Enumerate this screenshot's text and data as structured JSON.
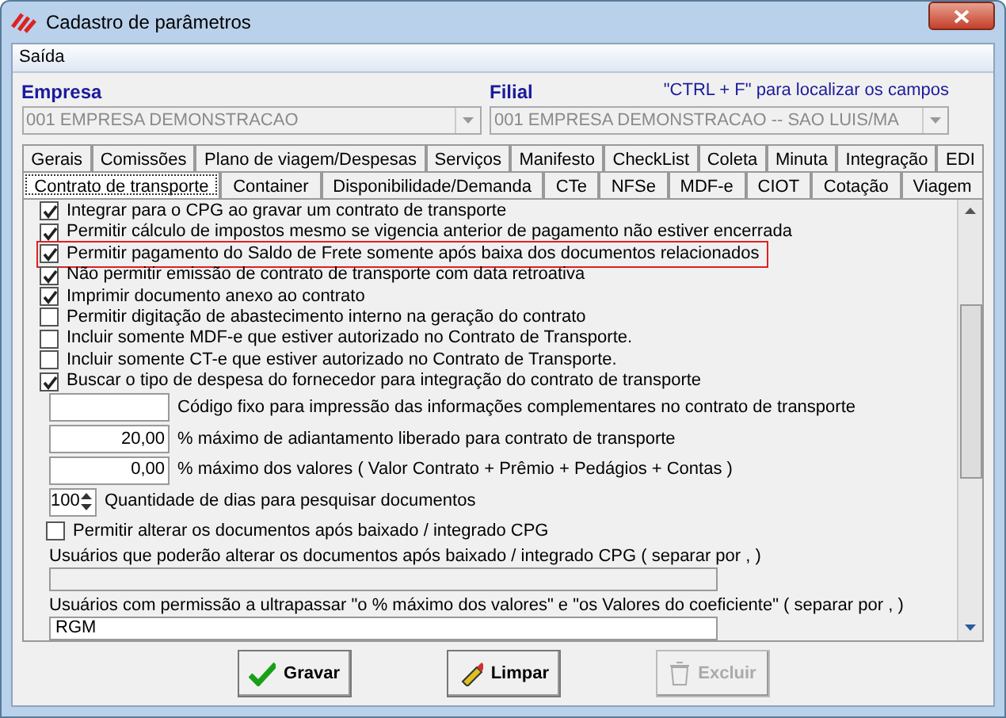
{
  "window": {
    "title": "Cadastro de parâmetros"
  },
  "menu": [
    "Saída"
  ],
  "empresa": {
    "label": "Empresa",
    "value": "001 EMPRESA DEMONSTRACAO"
  },
  "filial": {
    "label": "Filial",
    "value": "001 EMPRESA DEMONSTRACAO -- SAO LUIS/MA",
    "hint": "\"CTRL + F\" para localizar os campos"
  },
  "tab_rows": [
    [
      {
        "label": "Gerais",
        "selected": false
      },
      {
        "label": "Comissões",
        "selected": false
      },
      {
        "label": "Plano de viagem/Despesas",
        "selected": false
      },
      {
        "label": "Serviços",
        "selected": false
      },
      {
        "label": "Manifesto",
        "selected": false
      },
      {
        "label": "CheckList",
        "selected": false
      },
      {
        "label": "Coleta",
        "selected": false
      },
      {
        "label": "Minuta",
        "selected": false
      },
      {
        "label": "Integração",
        "selected": false
      },
      {
        "label": "EDI",
        "selected": false
      }
    ],
    [
      {
        "label": "Contrato de transporte",
        "selected": true
      },
      {
        "label": "Container",
        "selected": false
      },
      {
        "label": "Disponibilidade/Demanda",
        "selected": false
      },
      {
        "label": "CTe",
        "selected": false
      },
      {
        "label": "NFSe",
        "selected": false
      },
      {
        "label": "MDF-e",
        "selected": false
      },
      {
        "label": "CIOT",
        "selected": false
      },
      {
        "label": "Cotação",
        "selected": false
      },
      {
        "label": "Viagem",
        "selected": false
      }
    ]
  ],
  "options": [
    {
      "kind": "check",
      "label": "Integrar para o CPG ao gravar um contrato de transporte",
      "checked": true,
      "highlighted": false
    },
    {
      "kind": "check",
      "label": "Permitir cálculo de impostos mesmo se vigencia anterior de pagamento não estiver encerrada",
      "checked": true,
      "highlighted": false
    },
    {
      "kind": "check",
      "label": "Permitir pagamento do Saldo de Frete somente após baixa dos documentos relacionados",
      "checked": true,
      "highlighted": true
    },
    {
      "kind": "check",
      "label": "Não permitir emissão de contrato de transporte com data retroativa",
      "checked": true,
      "highlighted": false
    },
    {
      "kind": "check",
      "label": "Imprimir documento anexo ao contrato",
      "checked": true,
      "highlighted": false
    },
    {
      "kind": "check",
      "label": "Permitir digitação de abastecimento interno na geração do contrato",
      "checked": false,
      "highlighted": false
    },
    {
      "kind": "check",
      "label": "Incluir somente MDF-e que estiver autorizado no Contrato de Transporte.",
      "checked": false,
      "highlighted": false
    },
    {
      "kind": "check",
      "label": "Incluir somente CT-e que estiver autorizado no Contrato de Transporte.",
      "checked": false,
      "highlighted": false
    },
    {
      "kind": "check",
      "label": "Buscar o tipo de despesa do fornecedor para integração do contrato de transporte",
      "checked": true,
      "highlighted": false
    },
    {
      "kind": "field",
      "caption": "Código fixo para impressão das informações complementares no contrato de transporte"
    },
    {
      "kind": "field",
      "value": "20,00",
      "caption": "% máximo de adiantamento liberado para contrato de transporte"
    },
    {
      "kind": "field",
      "value": "0,00",
      "caption": "% máximo dos valores ( Valor Contrato + Prêmio + Pedágios + Contas )"
    },
    {
      "kind": "spin",
      "value": "100",
      "caption": "Quantidade de dias para pesquisar documentos"
    },
    {
      "kind": "check",
      "label": "Permitir alterar os documentos após baixado / integrado CPG",
      "checked": false,
      "highlighted": false
    },
    {
      "kind": "wide",
      "label": "Usuários que poderão alterar os documentos após baixado / integrado CPG ( separar por , )",
      "disabled": true
    },
    {
      "kind": "wide",
      "label": "Usuários com permissão a ultrapassar \"o % máximo dos valores\" e \"os Valores do coeficiente\"  ( separar por , )",
      "value": "RGM",
      "disabled": false
    }
  ],
  "buttons": [
    {
      "kind": "save",
      "label": "Gravar",
      "disabled": false
    },
    {
      "kind": "clear",
      "label": "Limpar",
      "disabled": false
    },
    {
      "kind": "delete",
      "label": "Excluir",
      "disabled": true
    }
  ]
}
